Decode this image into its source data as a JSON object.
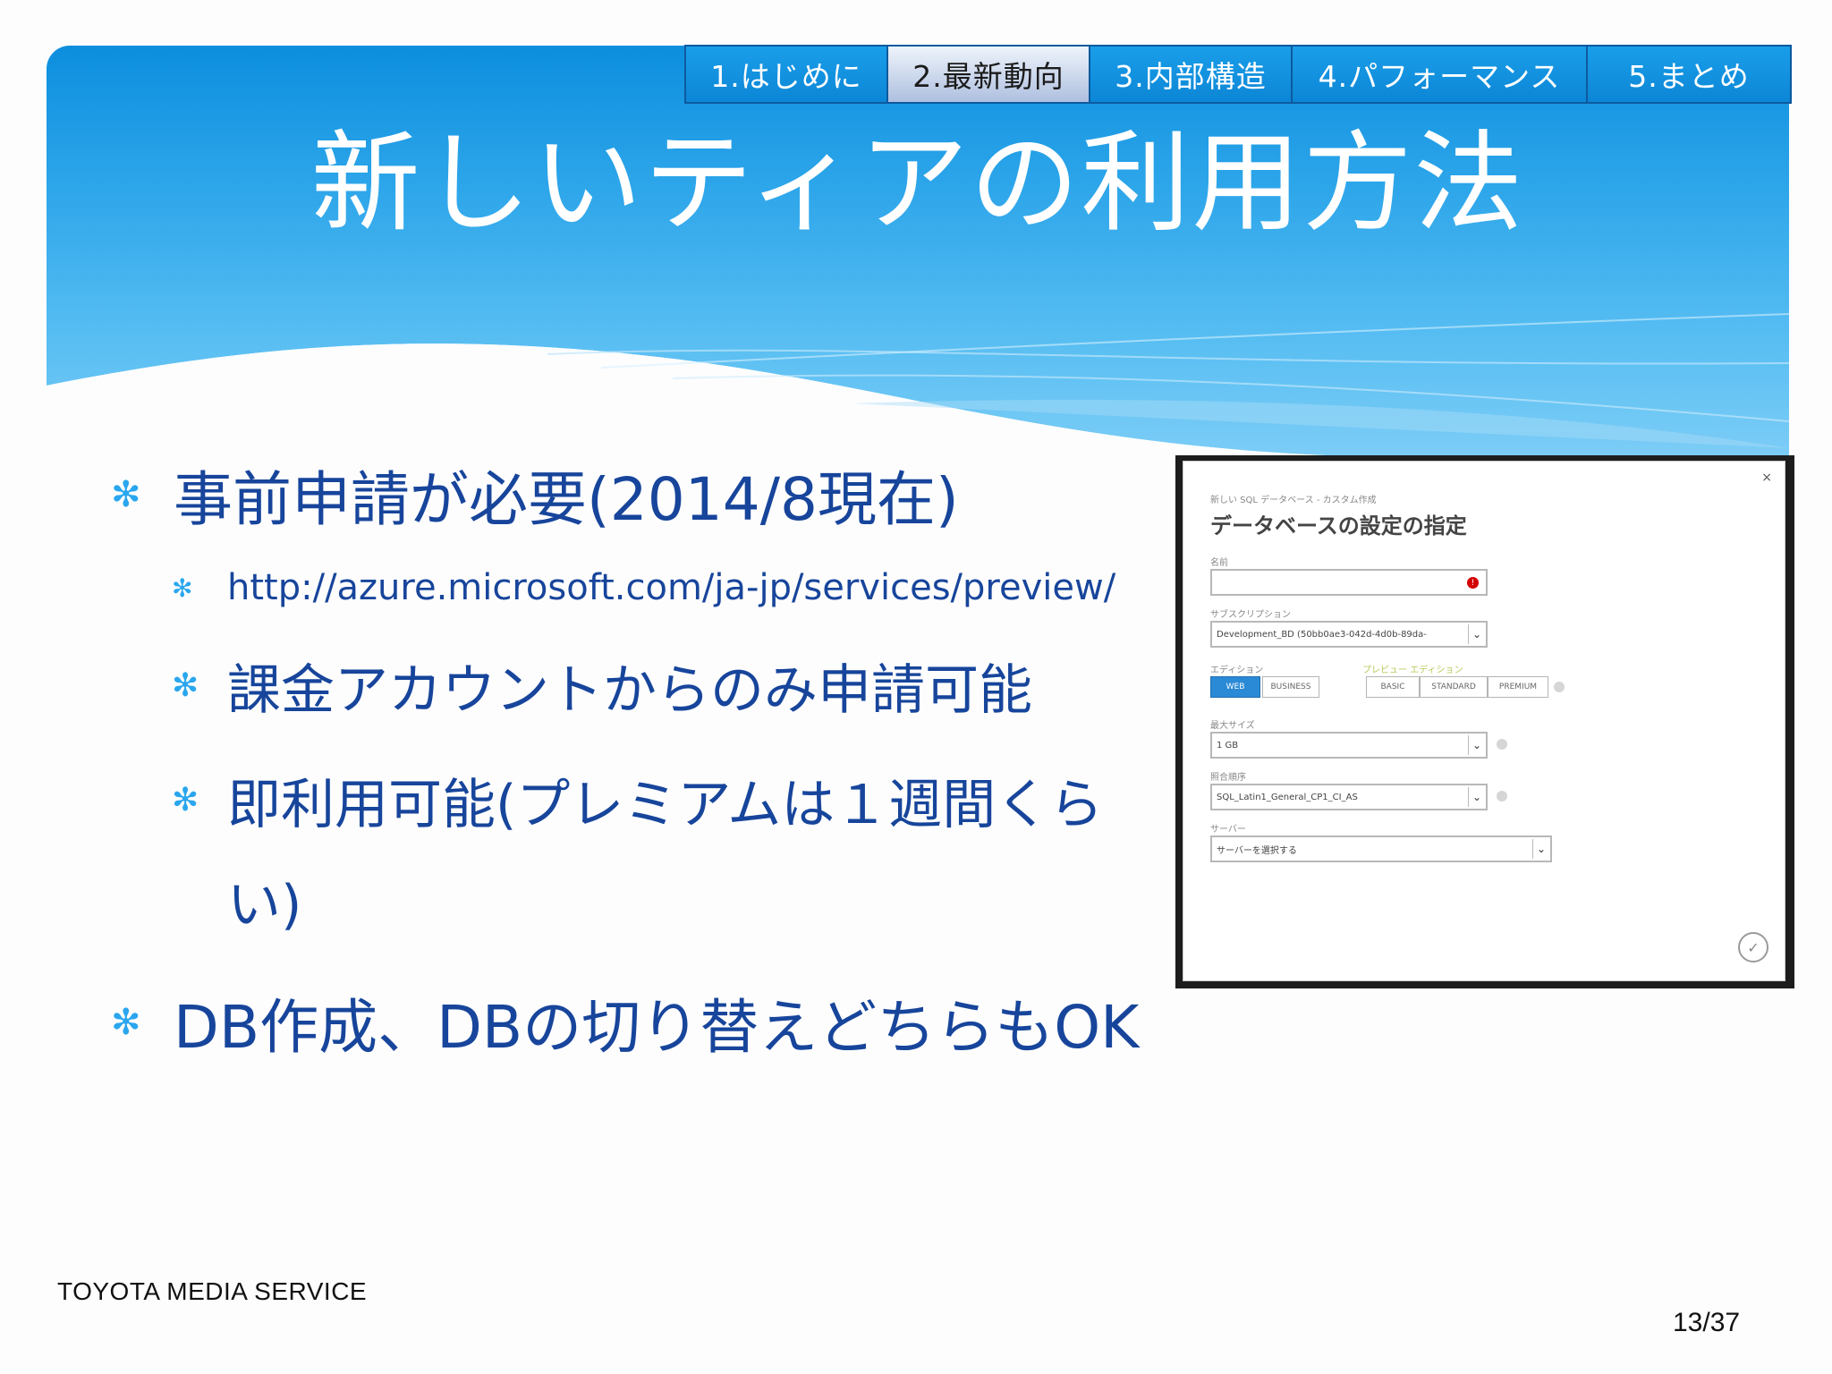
{
  "nav": {
    "tabs": [
      {
        "label": "1.はじめに"
      },
      {
        "label": "2.最新動向"
      },
      {
        "label": "3.内部構造"
      },
      {
        "label": "4.パフォーマンス"
      },
      {
        "label": "5.まとめ"
      }
    ],
    "active_index": 1
  },
  "title": "新しいティアの利用方法",
  "bullets": {
    "b1": "事前申請が必要(2014/8現在)",
    "b1_url": "http://azure.microsoft.com/ja-jp/services/preview/",
    "b1_sub1": "課金アカウントからのみ申請可能",
    "b1_sub2_line1": "即利用可能(プレミアムは１週間くら",
    "b1_sub2_line2": "い)",
    "b2": "DB作成、DBの切り替えどちらもOK"
  },
  "dialog": {
    "breadcrumb": "新しい SQL データベース - カスタム作成",
    "heading": "データベースの設定の指定",
    "close": "×",
    "name_label": "名前",
    "subscription_label": "サブスクリプション",
    "subscription_value": "Development_BD (50bb0ae3-042d-4d0b-89da-",
    "edition_label": "エディション",
    "preview_label": "プレビュー エディション",
    "edition_web": "WEB",
    "edition_business": "BUSINESS",
    "edition_basic": "BASIC",
    "edition_standard": "STANDARD",
    "edition_premium": "PREMIUM",
    "max_size_label": "最大サイズ",
    "max_size_value": "1 GB",
    "collation_label": "照合順序",
    "collation_value": "SQL_Latin1_General_CP1_CI_AS",
    "server_label": "サーバー",
    "server_value": "サーバーを選択する"
  },
  "footer": {
    "company": "TOYOTA MEDIA SERVICE",
    "page": "13/37"
  },
  "colors": {
    "header_blue": "#0c8ede",
    "bullet_text": "#17459b",
    "bullet_star": "#2aa6ee"
  }
}
